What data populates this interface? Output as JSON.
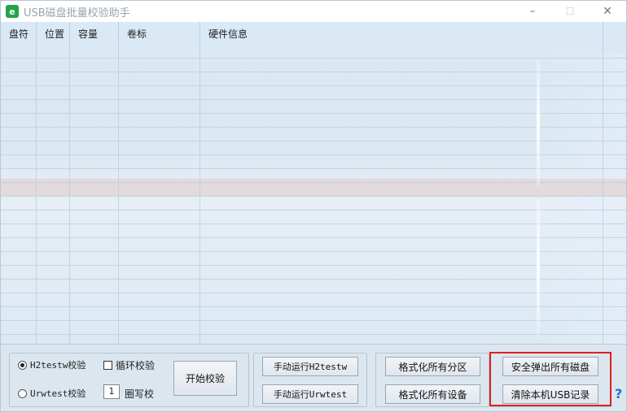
{
  "window": {
    "title": "USB磁盘批量校验助手",
    "controls": {
      "minimize": "–",
      "maximize": "☐",
      "close": "✕"
    }
  },
  "list": {
    "columns": [
      "盘符",
      "位置",
      "容量",
      "卷标",
      "硬件信息"
    ],
    "rows": []
  },
  "controls": {
    "radio_h2testw": "H2testw校验",
    "radio_urwtest": "Urwtest校验",
    "selected_mode": "H2testw校验",
    "loop_check_label": "循环校验",
    "loop_checked": false,
    "lap_count": "1",
    "lap_label": "圈写校",
    "start_button": "开始校验",
    "run_h2testw_button": "手动运行H2testw",
    "run_urwtest_button": "手动运行Urwtest",
    "format_partitions_button": "格式化所有分区",
    "format_devices_button": "格式化所有设备",
    "eject_all_button": "安全弹出所有磁盘",
    "clear_usb_button": "清除本机USB记录",
    "help": "?"
  },
  "colors": {
    "highlight": "#e0201b",
    "app_icon": "#22a447"
  }
}
